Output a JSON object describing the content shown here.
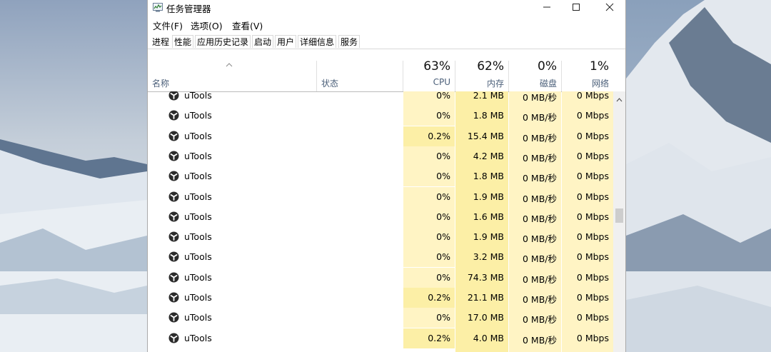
{
  "window": {
    "title": "任务管理器",
    "controls": {
      "minimize": "—",
      "maximize": "☐",
      "close": "✕"
    }
  },
  "menu": [
    "文件(F)",
    "选项(O)",
    "查看(V)"
  ],
  "tabs": [
    "进程",
    "性能",
    "应用历史记录",
    "启动",
    "用户",
    "详细信息",
    "服务"
  ],
  "columns": {
    "name": "名称",
    "status": "状态",
    "cpu": {
      "pct": "63%",
      "label": "CPU"
    },
    "memory": {
      "pct": "62%",
      "label": "内存"
    },
    "disk": {
      "pct": "0%",
      "label": "磁盘"
    },
    "network": {
      "pct": "1%",
      "label": "网络"
    }
  },
  "rows": [
    {
      "name": "uTools",
      "cpu": "0%",
      "memory": "2.1 MB",
      "disk": "0 MB/秒",
      "network": "0 Mbps",
      "cpu_highlight": false
    },
    {
      "name": "uTools",
      "cpu": "0%",
      "memory": "1.8 MB",
      "disk": "0 MB/秒",
      "network": "0 Mbps",
      "cpu_highlight": false
    },
    {
      "name": "uTools",
      "cpu": "0.2%",
      "memory": "15.4 MB",
      "disk": "0 MB/秒",
      "network": "0 Mbps",
      "cpu_highlight": true
    },
    {
      "name": "uTools",
      "cpu": "0%",
      "memory": "4.2 MB",
      "disk": "0 MB/秒",
      "network": "0 Mbps",
      "cpu_highlight": false
    },
    {
      "name": "uTools",
      "cpu": "0%",
      "memory": "1.8 MB",
      "disk": "0 MB/秒",
      "network": "0 Mbps",
      "cpu_highlight": false
    },
    {
      "name": "uTools",
      "cpu": "0%",
      "memory": "1.9 MB",
      "disk": "0 MB/秒",
      "network": "0 Mbps",
      "cpu_highlight": false
    },
    {
      "name": "uTools",
      "cpu": "0%",
      "memory": "1.6 MB",
      "disk": "0 MB/秒",
      "network": "0 Mbps",
      "cpu_highlight": false
    },
    {
      "name": "uTools",
      "cpu": "0%",
      "memory": "1.9 MB",
      "disk": "0 MB/秒",
      "network": "0 Mbps",
      "cpu_highlight": false
    },
    {
      "name": "uTools",
      "cpu": "0%",
      "memory": "3.2 MB",
      "disk": "0 MB/秒",
      "network": "0 Mbps",
      "cpu_highlight": false
    },
    {
      "name": "uTools",
      "cpu": "0%",
      "memory": "74.3 MB",
      "disk": "0 MB/秒",
      "network": "0 Mbps",
      "cpu_highlight": false
    },
    {
      "name": "uTools",
      "cpu": "0.2%",
      "memory": "21.1 MB",
      "disk": "0 MB/秒",
      "network": "0 Mbps",
      "cpu_highlight": true
    },
    {
      "name": "uTools",
      "cpu": "0%",
      "memory": "17.0 MB",
      "disk": "0 MB/秒",
      "network": "0 Mbps",
      "cpu_highlight": false
    },
    {
      "name": "uTools",
      "cpu": "0.2%",
      "memory": "4.0 MB",
      "disk": "0 MB/秒",
      "network": "0 Mbps",
      "cpu_highlight": true
    }
  ],
  "colors": {
    "heat_light": "#fff4c4",
    "heat_medium": "#fcefa6",
    "header_label": "#4c607a"
  },
  "icons": {
    "app": "task-manager-icon",
    "process": "utools-icon",
    "sort": "sort-ascending-caret-icon",
    "scroll_up": "chevron-up-icon"
  }
}
